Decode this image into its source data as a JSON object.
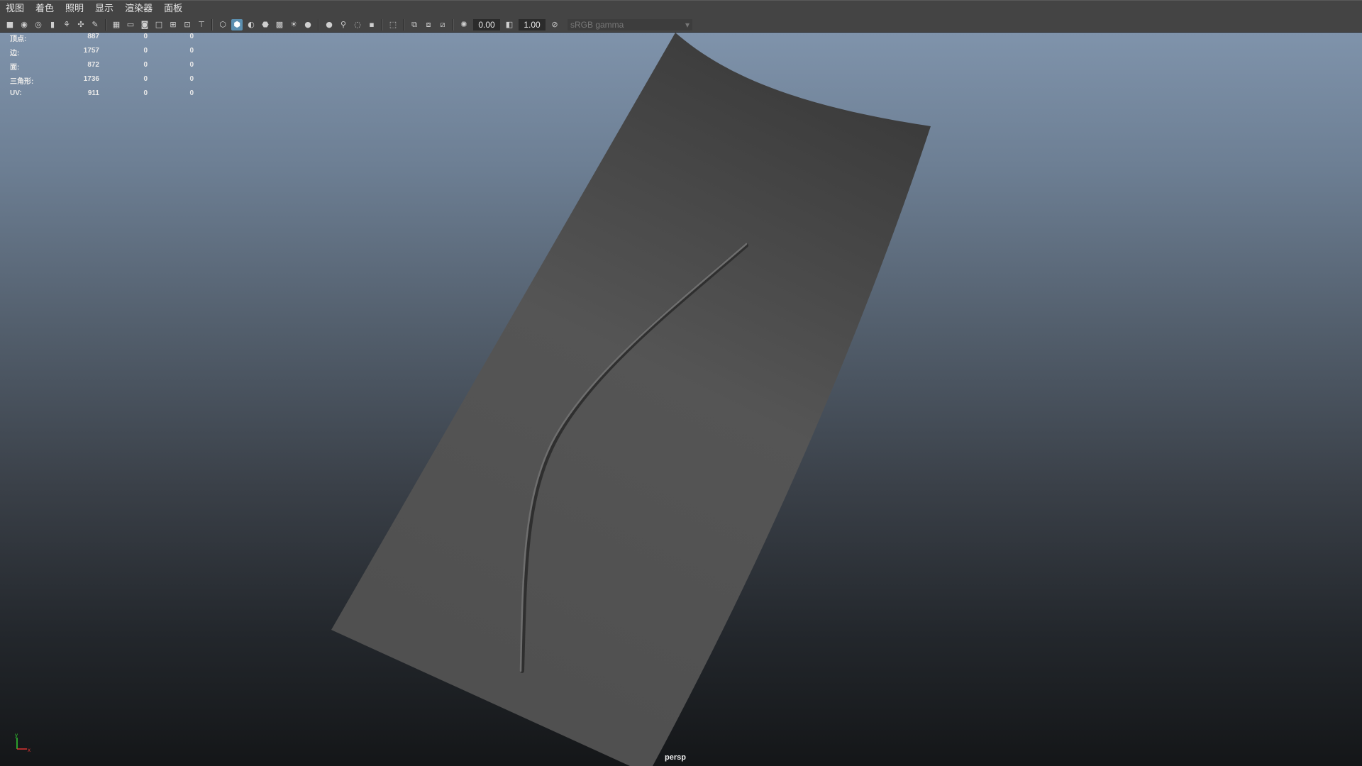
{
  "menu": [
    "视图",
    "着色",
    "照明",
    "显示",
    "渲染器",
    "面板"
  ],
  "toolbar": {
    "exposure_value": "0.00",
    "gamma_value": "1.00",
    "color_space": "sRGB gamma",
    "icons": [
      "camera-icon",
      "camera-attributes-icon",
      "bookmark-icon",
      "image-plane-icon",
      "grid-icon",
      "film-gate-icon",
      "resolution-gate-icon",
      "gate-mask-icon",
      "field-chart-icon",
      "safe-action-icon",
      "safe-title-icon",
      "wireframe-icon",
      "smooth-shade-icon",
      "wireframe-on-shaded-icon",
      "textured-icon",
      "use-lights-icon",
      "shadows-icon",
      "screen-ambient-occlusion-icon",
      "motion-blur-icon",
      "anti-aliasing-icon",
      "depth-of-field-icon",
      "isolate-select-icon",
      "xray-icon",
      "xray-joints-icon",
      "backface-culling-icon",
      "exposure-icon",
      "gamma-icon",
      "view-transform-icon"
    ]
  },
  "hud": {
    "rows": [
      {
        "label": "顶点:",
        "v1": "887",
        "v2": "0",
        "v3": "0"
      },
      {
        "label": "边:",
        "v1": "1757",
        "v2": "0",
        "v3": "0"
      },
      {
        "label": "面:",
        "v1": "872",
        "v2": "0",
        "v3": "0"
      },
      {
        "label": "三角形:",
        "v1": "1736",
        "v2": "0",
        "v3": "0"
      },
      {
        "label": "UV:",
        "v1": "911",
        "v2": "0",
        "v3": "0"
      }
    ]
  },
  "camera_label": "persp",
  "axis": {
    "y": "y",
    "x": "x",
    "x_color": "#d33",
    "y_color": "#3c3"
  }
}
